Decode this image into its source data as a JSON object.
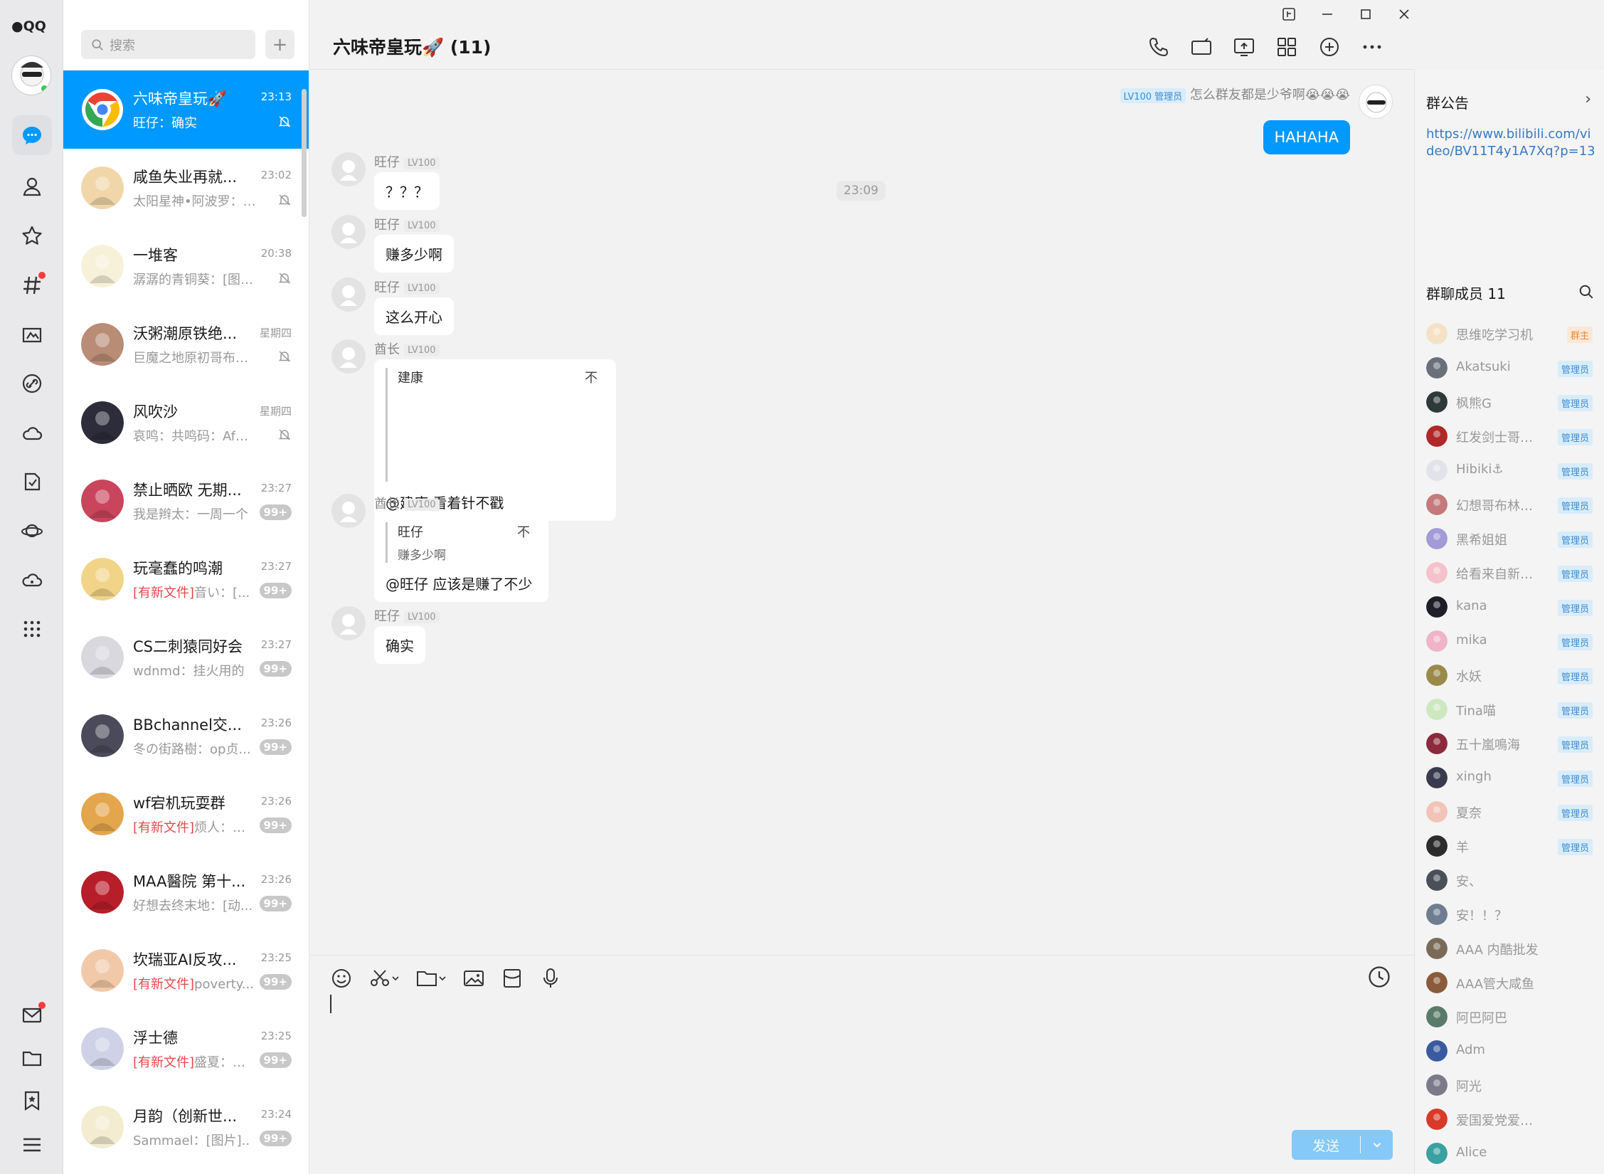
{
  "app": {
    "name": "QQ"
  },
  "search": {
    "placeholder": "搜索"
  },
  "conversations": [
    {
      "name": "六味帝皇玩🚀",
      "time": "23:13",
      "tag": "",
      "preview": "旺仔：确实",
      "badge": "",
      "muted": true,
      "active": true,
      "color": "#ffffff"
    },
    {
      "name": "咸鱼失业再就...",
      "time": "23:02",
      "tag": "",
      "preview": "太阳星神•阿波罗：被...",
      "badge": "",
      "muted": true,
      "active": false,
      "color": "#f0d6a8"
    },
    {
      "name": "一堆客",
      "time": "20:38",
      "tag": "",
      "preview": "潺潺的青铜葵：[图片]",
      "badge": "",
      "muted": true,
      "active": false,
      "color": "#f6f1d8"
    },
    {
      "name": "沃粥潮原铁绝...",
      "time": "星期四",
      "tag": "",
      "preview": "巨魔之地原初哥布林：...",
      "badge": "",
      "muted": true,
      "active": false,
      "color": "#b98c76"
    },
    {
      "name": "风吹沙",
      "time": "星期四",
      "tag": "",
      "preview": "哀鸣：共鸣码：AfQiJA...",
      "badge": "",
      "muted": true,
      "active": false,
      "color": "#2c2c3a"
    },
    {
      "name": "禁止晒欧 无期...",
      "time": "23:27",
      "tag": "",
      "preview": "我是辫太：一周一个",
      "badge": "99+",
      "muted": false,
      "active": false,
      "color": "#c9455c"
    },
    {
      "name": "玩毫蠢的鸣潮",
      "time": "23:27",
      "tag": "[有新文件]",
      "preview": "音い：[...",
      "badge": "99+",
      "muted": false,
      "active": false,
      "color": "#f2d488"
    },
    {
      "name": "CS二刺猿同好会",
      "time": "23:27",
      "tag": "",
      "preview": "wdnmd：挂火用的",
      "badge": "99+",
      "muted": false,
      "active": false,
      "color": "#d8d8de"
    },
    {
      "name": "BBchannel交...",
      "time": "23:26",
      "tag": "",
      "preview": "冬の街路樹：op贞...",
      "badge": "99+",
      "muted": false,
      "active": false,
      "color": "#4a4a5a"
    },
    {
      "name": "wf宕机玩耍群",
      "time": "23:26",
      "tag": "[有新文件]",
      "preview": "烦人：阿...",
      "badge": "99+",
      "muted": false,
      "active": false,
      "color": "#e4a64c"
    },
    {
      "name": "MAA醫院 第十...",
      "time": "23:26",
      "tag": "",
      "preview": "好想去终末地：[动...",
      "badge": "99+",
      "muted": false,
      "active": false,
      "color": "#b81e2a"
    },
    {
      "name": "坎瑞亚AI反攻...",
      "time": "23:25",
      "tag": "[有新文件]",
      "preview": "poverty...",
      "badge": "99+",
      "muted": false,
      "active": false,
      "color": "#f2c9a8"
    },
    {
      "name": "浮士德",
      "time": "23:25",
      "tag": "[有新文件]",
      "preview": "盛夏：正...",
      "badge": "99+",
      "muted": false,
      "active": false,
      "color": "#cfd2e6"
    },
    {
      "name": "月韵（创新世...",
      "time": "23:24",
      "tag": "",
      "preview": "Sammael：[图片]..",
      "badge": "99+",
      "muted": false,
      "active": false,
      "color": "#f4ecd0"
    }
  ],
  "chat": {
    "title": "六味帝皇玩🚀 (11)",
    "self_message": {
      "level": "LV100 管理员",
      "name": "怎么群友都是少爷啊😭😭😭",
      "text": "HAHAHA"
    },
    "time_divider": "23:09",
    "messages": [
      {
        "name": "旺仔",
        "level": "LV100",
        "text": "？？？"
      },
      {
        "name": "旺仔",
        "level": "LV100",
        "text": "赚多少啊"
      },
      {
        "name": "旺仔",
        "level": "LV100",
        "text": "这么开心"
      },
      {
        "name": "酋长",
        "level": "LV100",
        "quote_name": "建康",
        "quote_text": "",
        "text": "@建康 看着针不戳"
      },
      {
        "name": "酋长",
        "level": "LV100",
        "quote_name": "旺仔",
        "quote_text": "赚多少啊",
        "text": "@旺仔 应该是赚了不少"
      },
      {
        "name": "旺仔",
        "level": "LV100",
        "text": "确实"
      }
    ],
    "quote_icon": "不",
    "send_label": "发送"
  },
  "side": {
    "notice_title": "群公告",
    "notice_link": "https://www.bilibili.com/video/BV11T4y1A7Xq?p=13",
    "members_title": "群聊成员 11",
    "members": [
      {
        "name": "思维吃学习机",
        "badge": "群主",
        "color": "#f5e2c6"
      },
      {
        "name": "Akatsuki",
        "badge": "管理员",
        "color": "#6a6f7a"
      },
      {
        "name": "枫熊G",
        "badge": "管理员",
        "color": "#2e3a3a"
      },
      {
        "name": "红发剑士哥布...",
        "badge": "管理员",
        "color": "#b02828"
      },
      {
        "name": "Hibiki⚓",
        "badge": "管理员",
        "color": "#e2e2ea"
      },
      {
        "name": "幻想哥布林丶...",
        "badge": "管理员",
        "color": "#c47a7a"
      },
      {
        "name": "黑希姐姐",
        "badge": "管理员",
        "color": "#a39ad8"
      },
      {
        "name": "给看来自新世...",
        "badge": "管理员",
        "color": "#f4c2cc"
      },
      {
        "name": "kana",
        "badge": "管理员",
        "color": "#1e1e28"
      },
      {
        "name": "mika",
        "badge": "管理员",
        "color": "#efb4c8"
      },
      {
        "name": "水妖",
        "badge": "管理员",
        "color": "#9a8a4a"
      },
      {
        "name": "Tina喵",
        "badge": "管理员",
        "color": "#cde8c0"
      },
      {
        "name": "五十嵐鳴海",
        "badge": "管理员",
        "color": "#8a2a3a"
      },
      {
        "name": "xingh",
        "badge": "管理员",
        "color": "#3a3a4e"
      },
      {
        "name": "夏奈",
        "badge": "管理员",
        "color": "#f2c4b8"
      },
      {
        "name": "羊",
        "badge": "管理员",
        "color": "#2c2c2c"
      },
      {
        "name": "安、",
        "badge": "",
        "color": "#4a4f58"
      },
      {
        "name": "安！！？",
        "badge": "",
        "color": "#6e7e90"
      },
      {
        "name": "AAA 内酷批发",
        "badge": "",
        "color": "#7a6a5a"
      },
      {
        "name": "AAA管大咸鱼",
        "badge": "",
        "color": "#8a5a3a"
      },
      {
        "name": "阿巴阿巴",
        "badge": "",
        "color": "#5a7a6a"
      },
      {
        "name": "Adm",
        "badge": "",
        "color": "#3a5aa0"
      },
      {
        "name": "阿光",
        "badge": "",
        "color": "#7a7a8a"
      },
      {
        "name": "爱国爱党爱人民",
        "badge": "",
        "color": "#d83a2a"
      },
      {
        "name": "Alice",
        "badge": "",
        "color": "#3aa0a0"
      }
    ]
  },
  "colors": {
    "accent": "#0099ff",
    "admin_badge": "#3d8bd0",
    "owner_badge": "#e58a3a",
    "file_tag": "#e24b4b"
  }
}
